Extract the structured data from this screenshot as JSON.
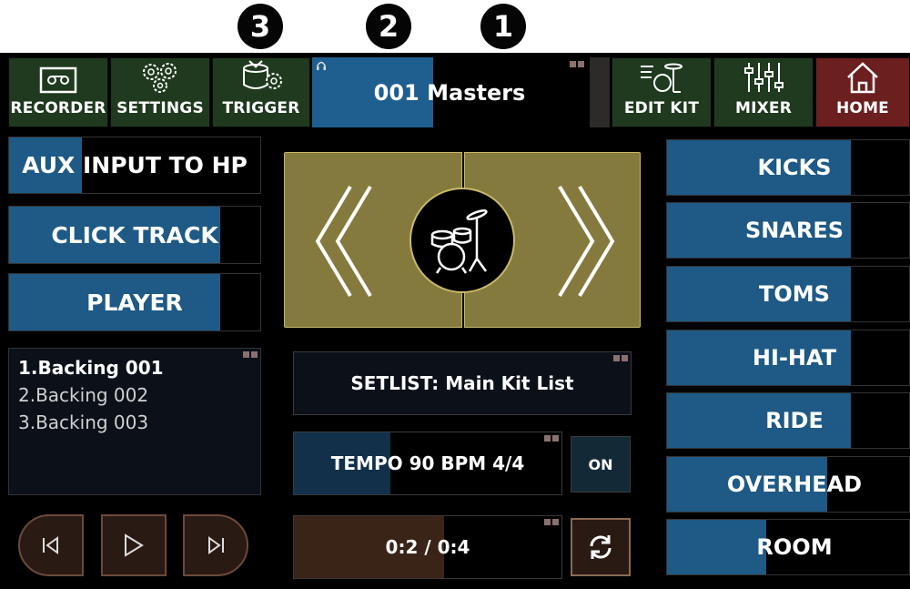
{
  "callouts": [
    "3",
    "2",
    "1"
  ],
  "topbar": {
    "recorder": "RECORDER",
    "settings": "SETTINGS",
    "trigger": "TRIGGER",
    "kit_name": "001 Masters",
    "kit_fill_fraction": 0.44,
    "edit_kit": "EDIT KIT",
    "mixer": "MIXER",
    "home": "HOME"
  },
  "left": {
    "aux": {
      "label": "AUX INPUT TO HP",
      "level": 0.29
    },
    "click": {
      "label": "CLICK TRACK",
      "level": 0.84
    },
    "player": {
      "label": "PLAYER",
      "level": 0.84
    },
    "playlist": [
      "1.Backing 001",
      "2.Backing 002",
      "3.Backing 003"
    ],
    "selected_index": 0
  },
  "transport": {
    "prev_icon": "skip-previous-icon",
    "play_icon": "play-icon",
    "next_icon": "skip-next-icon"
  },
  "center": {
    "prev_kit_icon": "chevron-left-icon",
    "next_kit_icon": "chevron-right-icon",
    "drum_icon": "drum-kit-icon",
    "setlist": "SETLIST: Main Kit List",
    "tempo": {
      "label": "TEMPO 90 BPM 4/4",
      "level": 0.36
    },
    "tempo_toggle": "ON",
    "progress": {
      "label": "0:2 / 0:4",
      "level": 0.56
    },
    "loop_icon": "loop-icon"
  },
  "right": {
    "groups": [
      {
        "label": "KICKS",
        "level": 0.76
      },
      {
        "label": "SNARES",
        "level": 0.76
      },
      {
        "label": "TOMS",
        "level": 0.76
      },
      {
        "label": "HI-HAT",
        "level": 0.76
      },
      {
        "label": "RIDE",
        "level": 0.76
      },
      {
        "label": "OVERHEAD",
        "level": 0.66
      },
      {
        "label": "ROOM",
        "level": 0.41
      }
    ]
  },
  "colors": {
    "fader_fill": "#1e5a85",
    "topbar_green": "#1f3a1f",
    "home_red": "#6b1f1f",
    "nav_gold": "#857a3d"
  }
}
